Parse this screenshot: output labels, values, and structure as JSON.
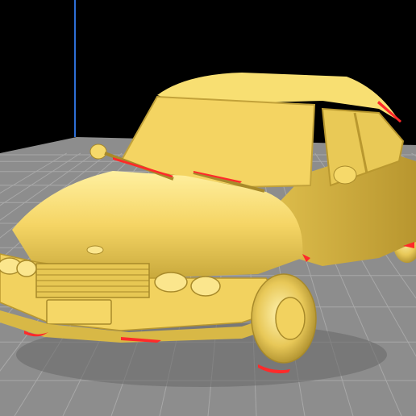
{
  "viewer": {
    "background_color": "#000000",
    "build_plate_color": "#8a8a8a",
    "grid_line_color": "#a8a8a8",
    "axis_color": "#2e6fd6",
    "model_color": "#f7dc6f",
    "overhang_color": "#ff2a2a"
  },
  "model": {
    "description_icon": "car-model-icon"
  }
}
